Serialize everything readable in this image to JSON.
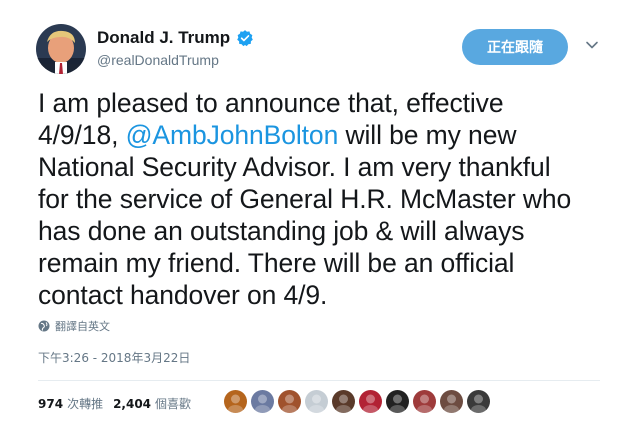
{
  "user": {
    "display_name": "Donald J. Trump",
    "handle": "@realDonaldTrump",
    "verified_icon": "verified-badge-icon",
    "avatar_icon": "profile-avatar"
  },
  "follow_button": {
    "label": "正在跟隨"
  },
  "menu": {
    "icon": "chevron-down-icon"
  },
  "tweet": {
    "line1": "I am pleased to announce that, effective",
    "line2_pre": "4/9/18, ",
    "mention": "@AmbJohnBolton",
    "line2_post": " will be my new",
    "line3": "National Security Advisor. I am very thankful",
    "line4": "for the service of General H.R. McMaster who",
    "line5": "has done an outstanding job & will always",
    "line6": "remain my friend. There will be an official",
    "line7": "contact handover on 4/9."
  },
  "translate": {
    "label": "翻譯自英文",
    "icon": "globe-icon"
  },
  "timestamp": "下午3:26 - 2018年3月22日",
  "stats": {
    "retweets_count": "974",
    "retweets_label": "次轉推",
    "likes_count": "2,404",
    "likes_label": "個喜歡"
  },
  "likers": [
    {
      "name": "liker-avatar-1",
      "color": "#b5651d"
    },
    {
      "name": "liker-avatar-2",
      "color": "#6b7aa1"
    },
    {
      "name": "liker-avatar-3",
      "color": "#a0522d"
    },
    {
      "name": "liker-avatar-4",
      "color": "#c5cdd4"
    },
    {
      "name": "liker-avatar-5",
      "color": "#5a3a2a"
    },
    {
      "name": "liker-avatar-6",
      "color": "#b22234"
    },
    {
      "name": "liker-avatar-7",
      "color": "#222222"
    },
    {
      "name": "liker-avatar-8",
      "color": "#9e3b3b"
    },
    {
      "name": "liker-avatar-9",
      "color": "#6d4c41"
    },
    {
      "name": "liker-avatar-10",
      "color": "#3a3a3a"
    }
  ],
  "colors": {
    "accent": "#1b95e0",
    "follow_button": "#59a8e0",
    "secondary_text": "#657786",
    "primary_text": "#14171a"
  }
}
